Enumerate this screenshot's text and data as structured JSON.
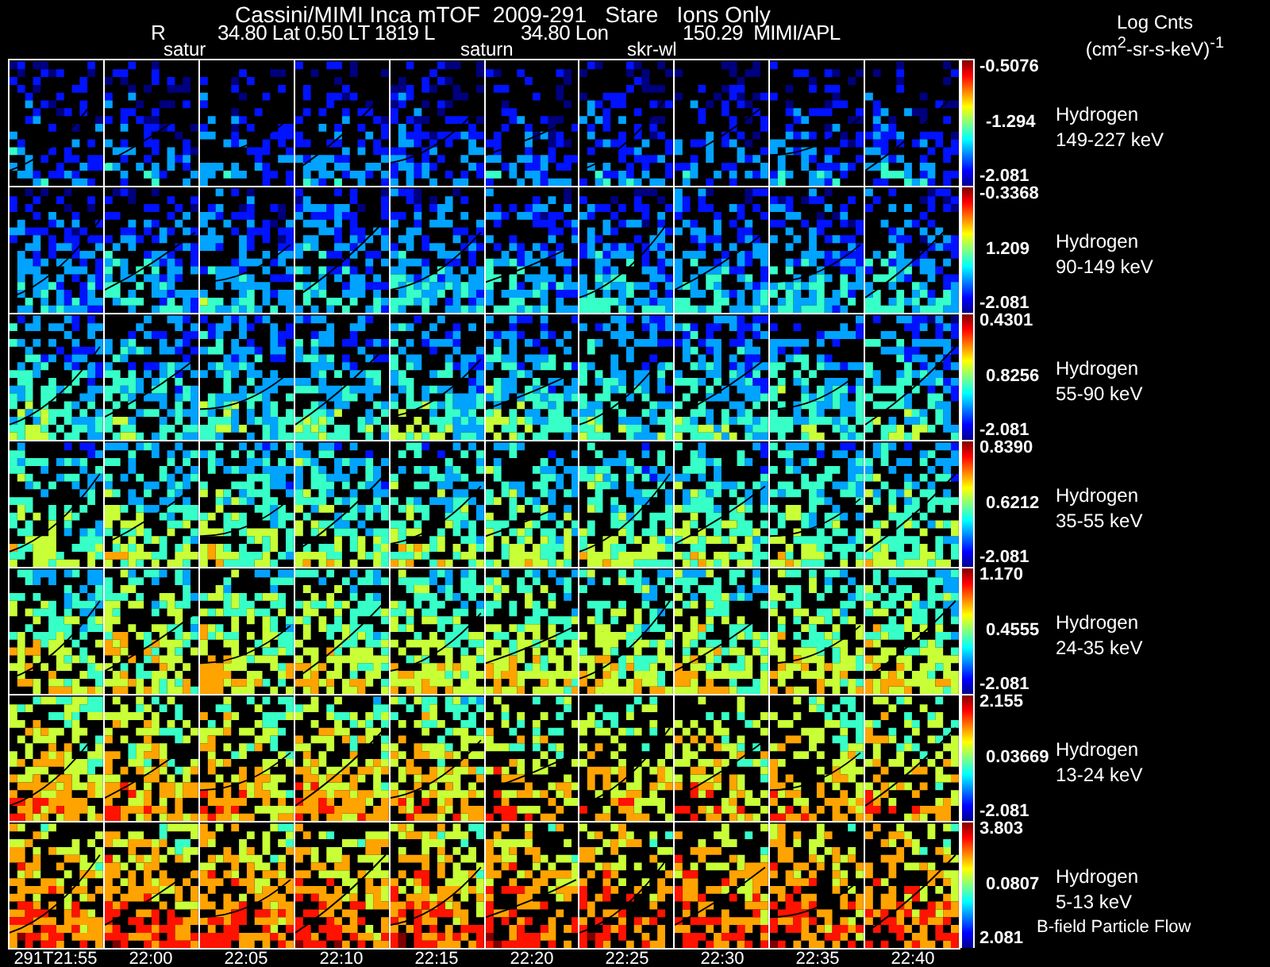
{
  "title": "Cassini/MIMI Inca mTOF  2009-291   Stare   Ions Only",
  "subtitle": [
    "R",
    "34.80 Lat 0.50 LT 1819 L",
    "34.80 Lon",
    "150.29  MIMI/APL"
  ],
  "units": {
    "label": "Log Cnts",
    "unit": "(cm$^{2}$-sr-s-keV)$^{-1}$"
  },
  "markers": [
    "satur",
    "saturn",
    "skr-wl"
  ],
  "rows": [
    {
      "species": "Hydrogen",
      "energy": "149-227 keV",
      "max": "-0.5076",
      "mid": "-1.294",
      "min": "-2.081"
    },
    {
      "species": "Hydrogen",
      "energy": "90-149 keV",
      "max": "-0.3368",
      "mid": "1.209",
      "min": "-2.081"
    },
    {
      "species": "Hydrogen",
      "energy": "55-90 keV",
      "max": "0.4301",
      "mid": "0.8256",
      "min": "-2.081"
    },
    {
      "species": "Hydrogen",
      "energy": "35-55 keV",
      "max": "0.8390",
      "mid": "0.6212",
      "min": "-2.081"
    },
    {
      "species": "Hydrogen",
      "energy": "24-35 keV",
      "max": "1.170",
      "mid": "0.4555",
      "min": "-2.081"
    },
    {
      "species": "Hydrogen",
      "energy": "13-24 keV",
      "max": "2.155",
      "mid": "0.03669",
      "min": "-2.081"
    },
    {
      "species": "Hydrogen",
      "energy": "5-13 keV",
      "max": "3.803",
      "mid": "0.0807",
      "min": "2.081"
    }
  ],
  "footer_note": "B-field Particle Flow",
  "times": [
    "291T21:55",
    "22:00",
    "22:05",
    "22:10",
    "22:15",
    "22:20",
    "22:25",
    "22:30",
    "22:35",
    "22:40"
  ]
}
